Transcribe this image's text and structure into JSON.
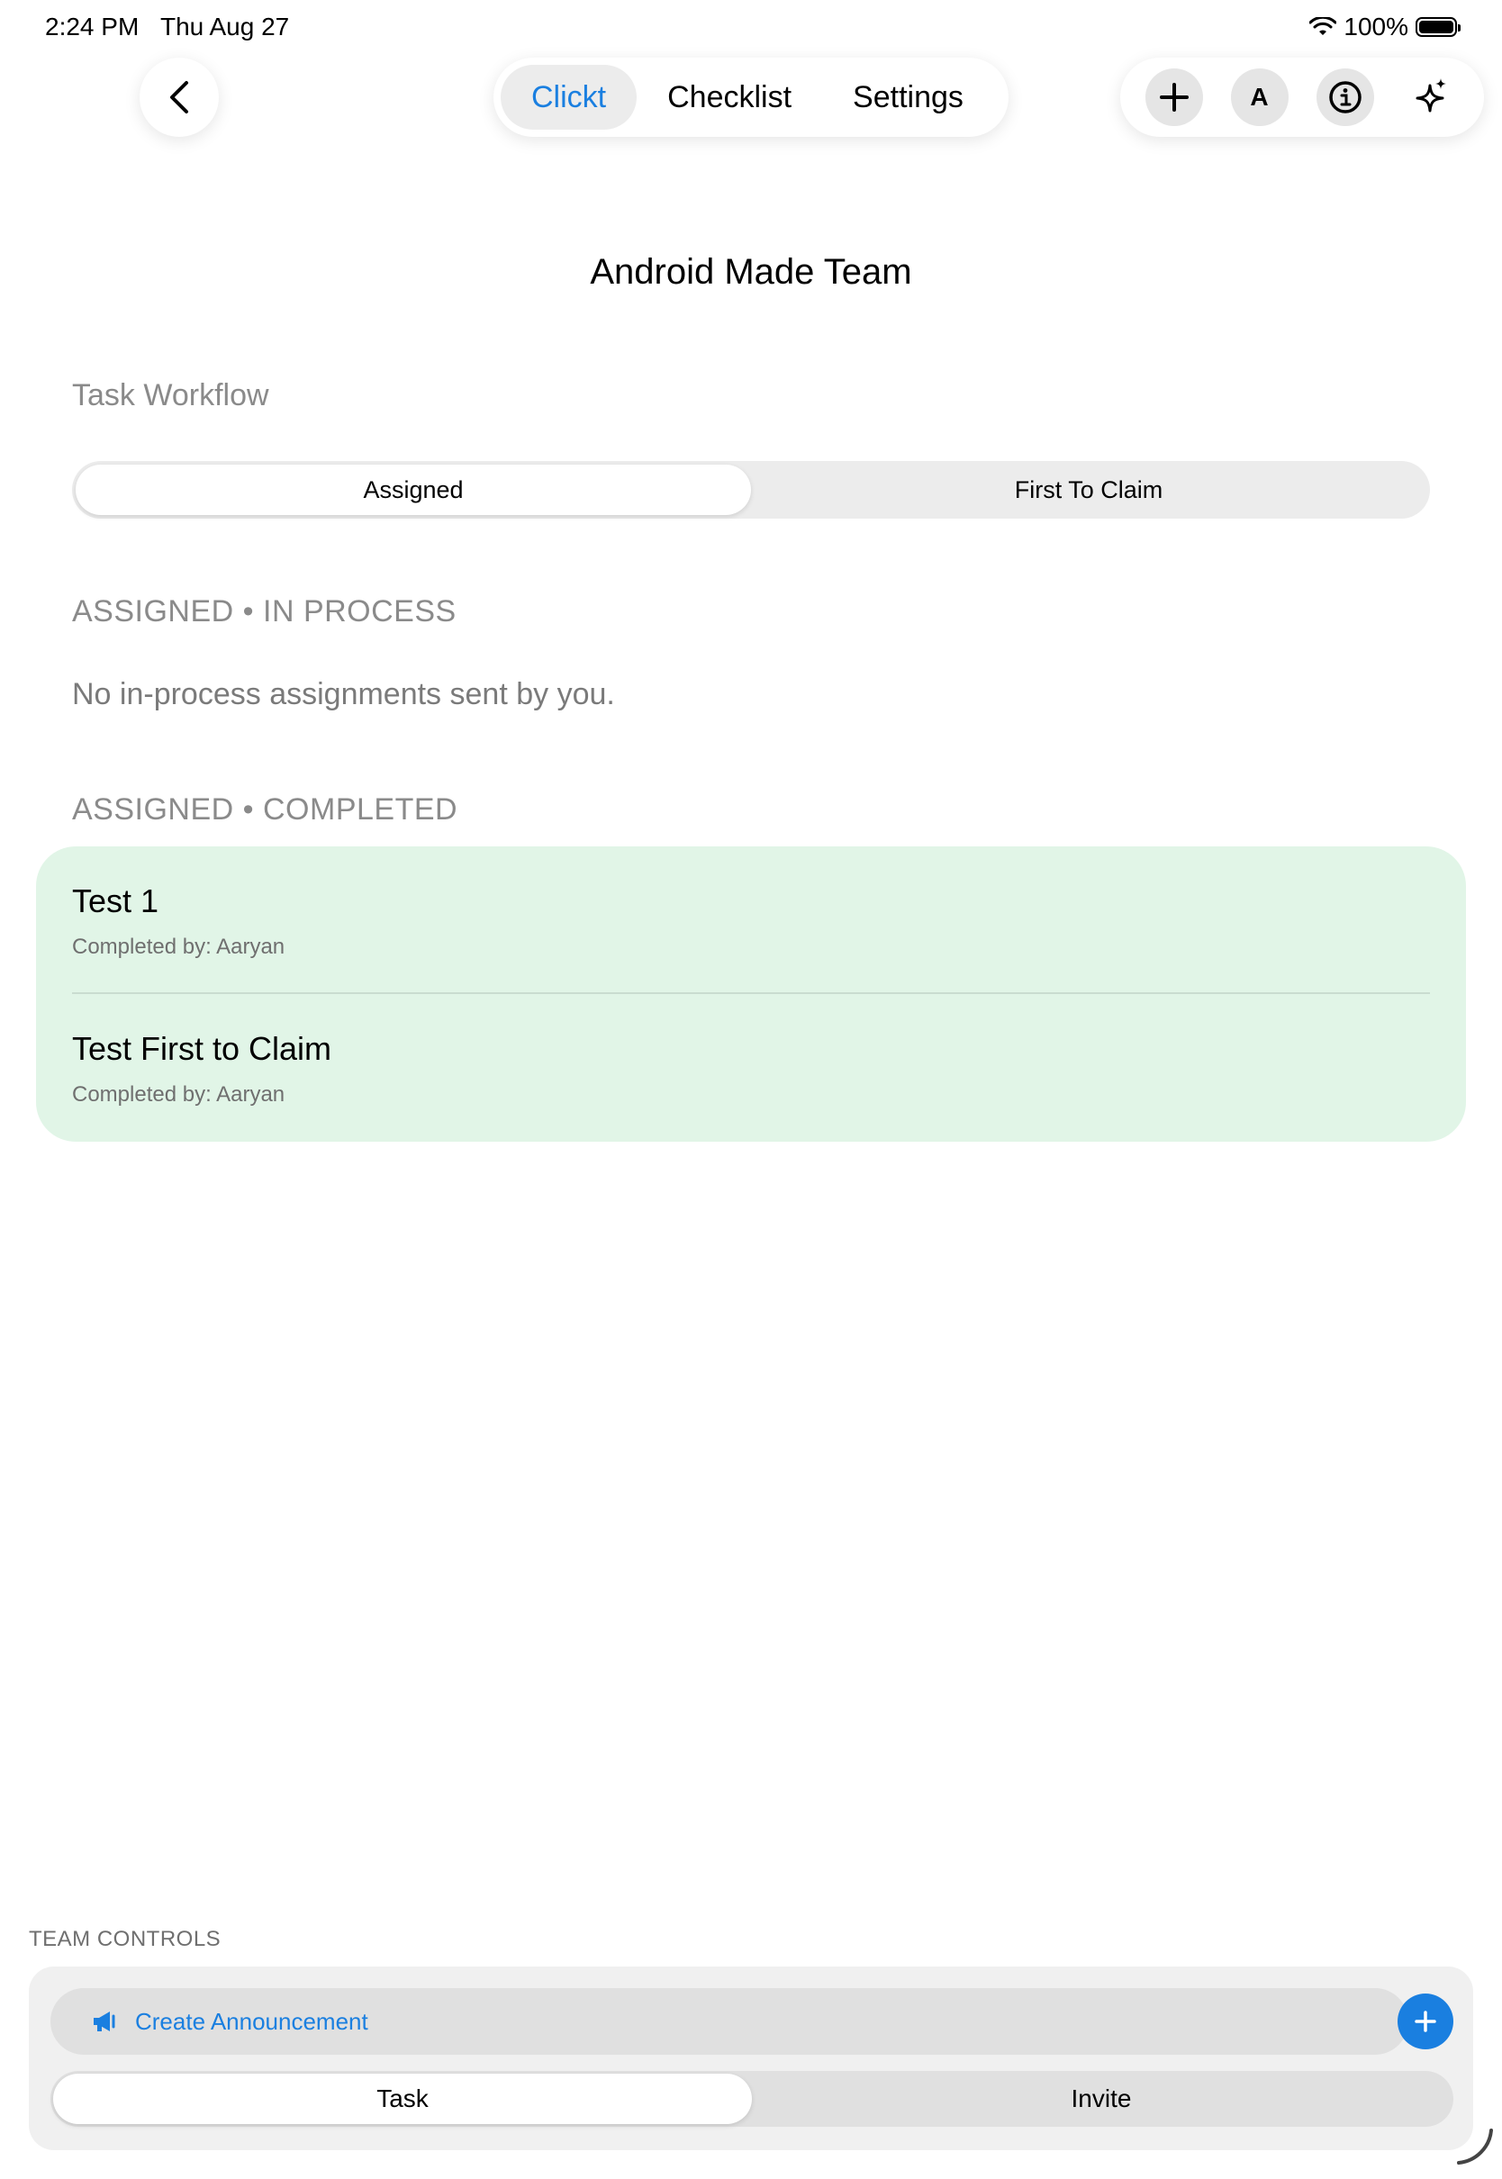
{
  "status_bar": {
    "time": "2:24 PM",
    "date": "Thu Aug 27",
    "battery": "100%"
  },
  "nav": {
    "tabs": [
      {
        "label": "Clickt",
        "active": true
      },
      {
        "label": "Checklist",
        "active": false
      },
      {
        "label": "Settings",
        "active": false
      }
    ],
    "tools": {
      "add_icon": "plus-icon",
      "avatar_letter": "A",
      "info_icon": "info-icon",
      "sparkle_icon": "sparkle-icon"
    }
  },
  "team_title": "Android Made Team",
  "workflow": {
    "label": "Task Workflow",
    "options": [
      {
        "label": "Assigned",
        "active": true
      },
      {
        "label": "First To Claim",
        "active": false
      }
    ]
  },
  "in_process": {
    "label": "ASSIGNED • IN PROCESS",
    "empty_text": "No in-process assignments sent by you."
  },
  "completed": {
    "label": "ASSIGNED • COMPLETED",
    "items": [
      {
        "title": "Test 1",
        "subtitle": "Completed by: Aaryan"
      },
      {
        "title": "Test First to Claim",
        "subtitle": "Completed by: Aaryan"
      }
    ]
  },
  "team_controls": {
    "label": "TEAM CONTROLS",
    "announcement_label": "Create Announcement",
    "options": [
      {
        "label": "Task",
        "active": true
      },
      {
        "label": "Invite",
        "active": false
      }
    ]
  },
  "colors": {
    "accent": "#1a7fe0",
    "completed_card": "#e1f5e7"
  }
}
